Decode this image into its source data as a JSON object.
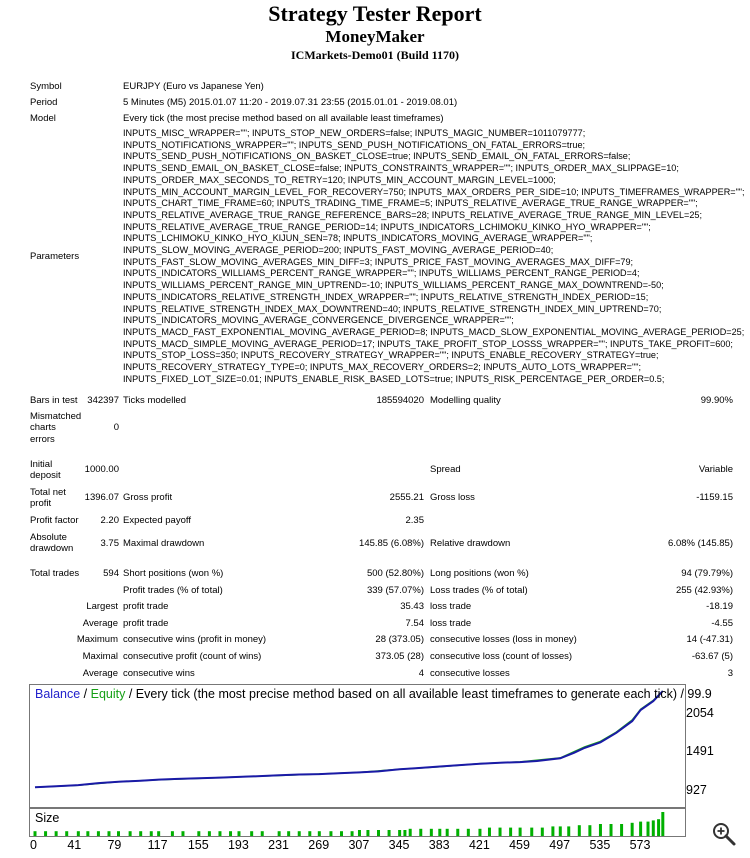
{
  "header": {
    "title": "Strategy Tester Report",
    "expert": "MoneyMaker",
    "server": "ICMarkets-Demo01 (Build 1170)"
  },
  "info": {
    "symbol_label": "Symbol",
    "symbol_value": "EURJPY (Euro vs Japanese Yen)",
    "period_label": "Period",
    "period_value": "5 Minutes (M5) 2015.01.07 11:20 - 2019.07.31 23:55 (2015.01.01 - 2019.08.01)",
    "model_label": "Model",
    "model_value": "Every tick (the most precise method based on all available least timeframes)",
    "parameters_label": "Parameters",
    "parameters_lines": [
      "INPUTS_MISC_WRAPPER=\"\"; INPUTS_STOP_NEW_ORDERS=false; INPUTS_MAGIC_NUMBER=1011079777;",
      "INPUTS_NOTIFICATIONS_WRAPPER=\"\"; INPUTS_SEND_PUSH_NOTIFICATIONS_ON_FATAL_ERRORS=true;",
      "INPUTS_SEND_PUSH_NOTIFICATIONS_ON_BASKET_CLOSE=true; INPUTS_SEND_EMAIL_ON_FATAL_ERRORS=false;",
      "INPUTS_SEND_EMAIL_ON_BASKET_CLOSE=false; INPUTS_CONSTRAINTS_WRAPPER=\"\"; INPUTS_ORDER_MAX_SLIPPAGE=10;",
      "INPUTS_ORDER_MAX_SECONDS_TO_RETRY=120; INPUTS_MIN_ACCOUNT_MARGIN_LEVEL=1000;",
      "INPUTS_MIN_ACCOUNT_MARGIN_LEVEL_FOR_RECOVERY=750; INPUTS_MAX_ORDERS_PER_SIDE=10; INPUTS_TIMEFRAMES_WRAPPER=\"\";",
      "INPUTS_CHART_TIME_FRAME=60; INPUTS_TRADING_TIME_FRAME=5; INPUTS_RELATIVE_AVERAGE_TRUE_RANGE_WRAPPER=\"\";",
      "INPUTS_RELATIVE_AVERAGE_TRUE_RANGE_REFERENCE_BARS=28; INPUTS_RELATIVE_AVERAGE_TRUE_RANGE_MIN_LEVEL=25;",
      "INPUTS_RELATIVE_AVERAGE_TRUE_RANGE_PERIOD=14; INPUTS_INDICATORS_LCHIMOKU_KINKO_HYO_WRAPPER=\"\";",
      "INPUTS_LCHIMOKU_KINKO_HYO_KIJUN_SEN=78; INPUTS_INDICATORS_MOVING_AVERAGE_WRAPPER=\"\";",
      "INPUTS_SLOW_MOVING_AVERAGE_PERIOD=200; INPUTS_FAST_MOVING_AVERAGE_PERIOD=40;",
      "INPUTS_FAST_SLOW_MOVING_AVERAGES_MIN_DIFF=3; INPUTS_PRICE_FAST_MOVING_AVERAGES_MAX_DIFF=79;",
      "INPUTS_INDICATORS_WILLIAMS_PERCENT_RANGE_WRAPPER=\"\"; INPUTS_WILLIAMS_PERCENT_RANGE_PERIOD=4;",
      "INPUTS_WILLIAMS_PERCENT_RANGE_MIN_UPTREND=-10; INPUTS_WILLIAMS_PERCENT_RANGE_MAX_DOWNTREND=-50;",
      "INPUTS_INDICATORS_RELATIVE_STRENGTH_INDEX_WRAPPER=\"\"; INPUTS_RELATIVE_STRENGTH_INDEX_PERIOD=15;",
      "INPUTS_RELATIVE_STRENGTH_INDEX_MAX_DOWNTREND=40; INPUTS_RELATIVE_STRENGTH_INDEX_MIN_UPTREND=70;",
      "INPUTS_INDICATORS_MOVING_AVERAGE_CONVERGENCE_DIVERGENCE_WRAPPER=\"\";",
      "INPUTS_MACD_FAST_EXPONENTIAL_MOVING_AVERAGE_PERIOD=8; INPUTS_MACD_SLOW_EXPONENTIAL_MOVING_AVERAGE_PERIOD=25;",
      "INPUTS_MACD_SIMPLE_MOVING_AVERAGE_PERIOD=17; INPUTS_TAKE_PROFIT_STOP_LOSSS_WRAPPER=\"\"; INPUTS_TAKE_PROFIT=600;",
      "INPUTS_STOP_LOSS=350; INPUTS_RECOVERY_STRATEGY_WRAPPER=\"\"; INPUTS_ENABLE_RECOVERY_STRATEGY=true;",
      "INPUTS_RECOVERY_STRATEGY_TYPE=0; INPUTS_MAX_RECOVERY_ORDERS=2; INPUTS_AUTO_LOTS_WRAPPER=\"\";",
      "INPUTS_FIXED_LOT_SIZE=0.01; INPUTS_ENABLE_RISK_BASED_LOTS=true; INPUTS_RISK_PERCENTAGE_PER_ORDER=0.5;"
    ]
  },
  "stats": {
    "bars_label": "Bars in test",
    "bars_value": "342397",
    "ticks_label": "Ticks modelled",
    "ticks_value": "185594020",
    "quality_label": "Modelling quality",
    "quality_value": "99.90%",
    "mismatch_label_1": "Mismatched",
    "mismatch_label_2": "charts",
    "mismatch_label_3": "errors",
    "mismatch_value": "0",
    "deposit_label_1": "Initial",
    "deposit_label_2": "deposit",
    "deposit_value": "1000.00",
    "spread_label": "Spread",
    "spread_value": "Variable",
    "netprofit_label_1": "Total net",
    "netprofit_label_2": "profit",
    "netprofit_value": "1396.07",
    "grossprofit_label": "Gross profit",
    "grossprofit_value": "2555.21",
    "grossloss_label": "Gross loss",
    "grossloss_value": "-1159.15",
    "pf_label": "Profit factor",
    "pf_value": "2.20",
    "ep_label": "Expected payoff",
    "ep_value": "2.35",
    "absdd_label_1": "Absolute",
    "absdd_label_2": "drawdown",
    "absdd_value": "3.75",
    "maxdd_label": "Maximal drawdown",
    "maxdd_value": "145.85 (6.08%)",
    "reldd_label": "Relative drawdown",
    "reldd_value": "6.08% (145.85)",
    "tt_label": "Total trades",
    "tt_value": "594",
    "short_label": "Short positions (won %)",
    "short_value": "500 (52.80%)",
    "long_label": "Long positions (won %)",
    "long_value": "94 (79.79%)",
    "pt_label": "Profit trades (% of total)",
    "pt_value": "339 (57.07%)",
    "lt_label": "Loss trades (% of total)",
    "lt_value": "255 (42.93%)",
    "largest_label": "Largest",
    "lp_label": "profit trade",
    "lp_value": "35.43",
    "ll_label": "loss trade",
    "ll_value": "-18.19",
    "average_label": "Average",
    "ap_label": "profit trade",
    "ap_value": "7.54",
    "al_label": "loss trade",
    "al_value": "-4.55",
    "maximum_label": "Maximum",
    "mcw_label": "consecutive wins (profit in money)",
    "mcw_value": "28 (373.05)",
    "mcl_label": "consecutive losses (loss in money)",
    "mcl_value": "14 (-47.31)",
    "maximal_label": "Maximal",
    "mcp_label": "consecutive profit (count of wins)",
    "mcp_value": "373.05 (28)",
    "mclc_label": "consecutive loss (count of losses)",
    "mclc_value": "-63.67 (5)",
    "average2_label": "Average",
    "acw_label": "consecutive wins",
    "acw_value": "4",
    "acl_label": "consecutive losses",
    "acl_value": "3"
  },
  "chart_title": {
    "balance": "Balance",
    "sep1": " / ",
    "equity": "Equity",
    "rest": " / Every tick (the most precise method based on all available least timeframes to generate each tick) / 99.9"
  },
  "size_label": "Size",
  "colors": {
    "balance": "#1a1aa6",
    "equity": "#16a016",
    "title_balance": "#2222cc",
    "size_bars": "#00b000"
  },
  "icons": {
    "zoom": "magnifier-plus-icon"
  },
  "chart_data": {
    "type": "line",
    "title": "Balance / Equity / Every tick (the most precise method based on all available least timeframes to generate each tick) / 99.9",
    "xlabel": "",
    "ylabel": "",
    "x_ticks": [
      0,
      41,
      79,
      117,
      155,
      193,
      231,
      269,
      307,
      345,
      383,
      421,
      459,
      497,
      535,
      573
    ],
    "y_ticks": [
      927,
      1491,
      2054
    ],
    "xlim": [
      0,
      615
    ],
    "ylim": [
      800,
      2396
    ],
    "series": [
      {
        "name": "Balance",
        "x": [
          0,
          20,
          41,
          60,
          79,
          100,
          117,
          135,
          155,
          175,
          193,
          210,
          231,
          250,
          269,
          290,
          307,
          325,
          345,
          360,
          383,
          400,
          421,
          440,
          459,
          475,
          497,
          510,
          520,
          535,
          550,
          565,
          573,
          585,
          594
        ],
        "values": [
          1000,
          1015,
          1030,
          1060,
          1080,
          1095,
          1110,
          1120,
          1130,
          1140,
          1150,
          1160,
          1175,
          1185,
          1190,
          1205,
          1215,
          1230,
          1260,
          1275,
          1300,
          1320,
          1340,
          1355,
          1365,
          1380,
          1420,
          1500,
          1570,
          1650,
          1790,
          1960,
          2120,
          2250,
          2396
        ]
      },
      {
        "name": "Equity",
        "x": [
          0,
          41,
          79,
          117,
          155,
          193,
          231,
          269,
          307,
          345,
          383,
          421,
          459,
          497,
          520,
          535,
          550,
          565,
          573,
          585,
          594
        ],
        "values": [
          1000,
          1028,
          1078,
          1108,
          1128,
          1150,
          1170,
          1192,
          1215,
          1262,
          1298,
          1342,
          1368,
          1425,
          1585,
          1665,
          1800,
          1975,
          2130,
          2260,
          2396
        ]
      }
    ],
    "size_bars": {
      "x": [
        0,
        10,
        20,
        30,
        41,
        50,
        60,
        70,
        79,
        90,
        100,
        110,
        117,
        130,
        140,
        155,
        165,
        175,
        185,
        193,
        205,
        215,
        231,
        240,
        250,
        260,
        269,
        280,
        290,
        300,
        307,
        315,
        325,
        335,
        345,
        350,
        355,
        365,
        375,
        383,
        390,
        400,
        410,
        421,
        430,
        440,
        450,
        459,
        470,
        480,
        490,
        497,
        505,
        515,
        525,
        535,
        545,
        555,
        565,
        573,
        580,
        585,
        590,
        594
      ],
      "values": [
        0.04,
        0.04,
        0.04,
        0.04,
        0.04,
        0.04,
        0.04,
        0.04,
        0.04,
        0.04,
        0.04,
        0.04,
        0.04,
        0.04,
        0.04,
        0.04,
        0.04,
        0.04,
        0.04,
        0.04,
        0.04,
        0.04,
        0.04,
        0.04,
        0.04,
        0.04,
        0.04,
        0.04,
        0.04,
        0.04,
        0.05,
        0.05,
        0.05,
        0.05,
        0.05,
        0.05,
        0.06,
        0.06,
        0.06,
        0.06,
        0.06,
        0.06,
        0.06,
        0.06,
        0.07,
        0.07,
        0.07,
        0.07,
        0.07,
        0.07,
        0.08,
        0.08,
        0.08,
        0.09,
        0.09,
        0.1,
        0.1,
        0.1,
        0.11,
        0.12,
        0.12,
        0.13,
        0.14,
        0.2
      ]
    }
  }
}
